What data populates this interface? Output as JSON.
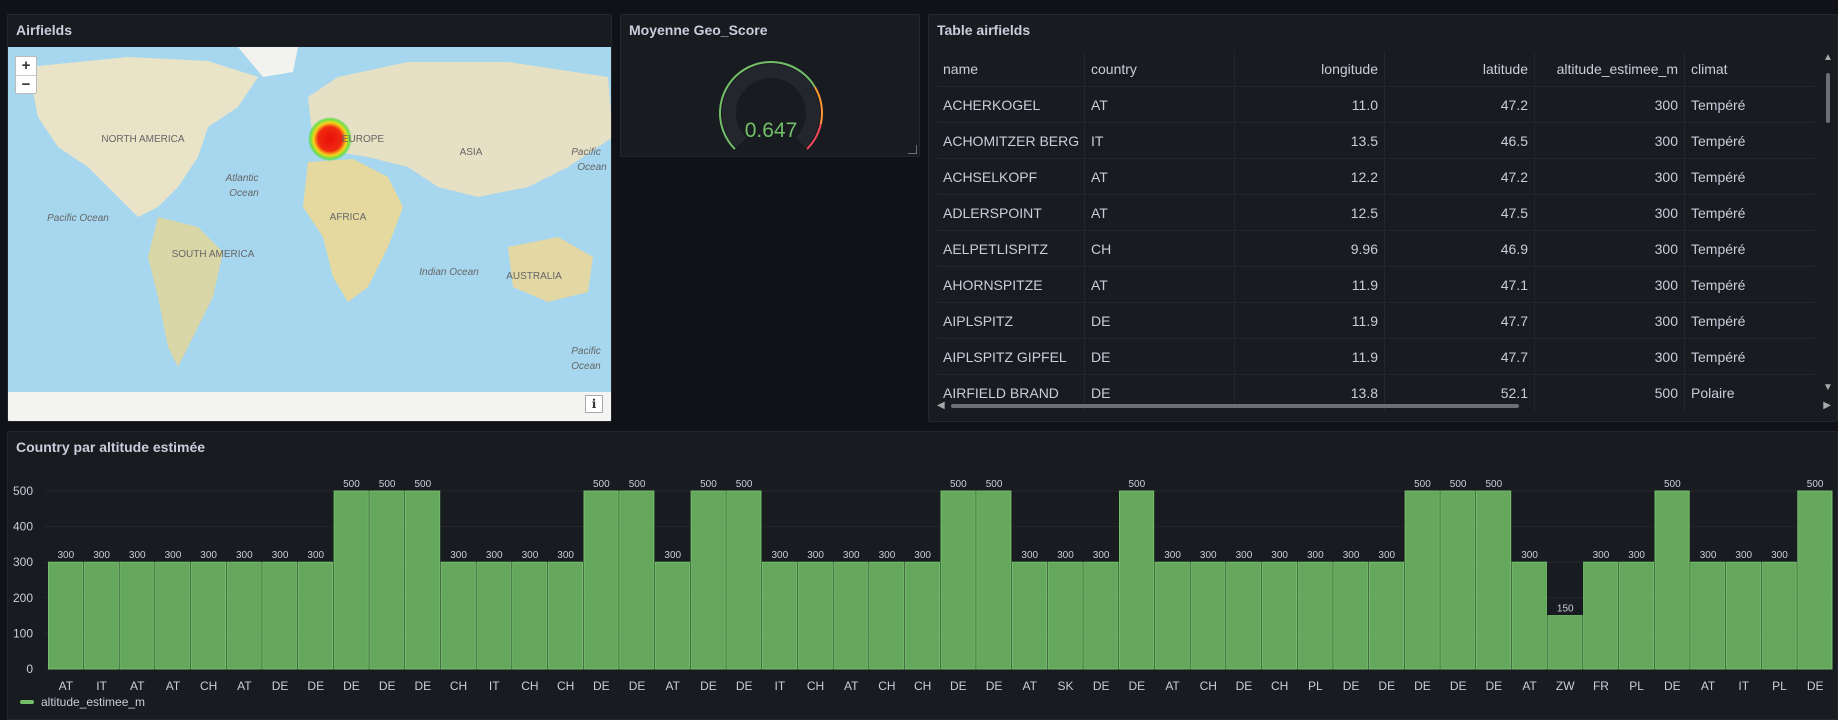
{
  "map_panel": {
    "title": "Airfields",
    "zoom_in": "+",
    "zoom_out": "−",
    "info": "i",
    "labels": [
      "NORTH AMERICA",
      "EUROPE",
      "ASIA",
      "Atlantic",
      "Ocean",
      "AFRICA",
      "Pacific Ocean",
      "SOUTH AMERICA",
      "Indian Ocean",
      "AUSTRALIA",
      "Pacific",
      "Ocean",
      "Pacific",
      "Ocean"
    ]
  },
  "gauge_panel": {
    "title": "Moyenne Geo_Score",
    "value": "0.647",
    "value_color": "#73bf69",
    "fraction": 0.647
  },
  "table_panel": {
    "title": "Table airfields",
    "columns": [
      "name",
      "country",
      "longitude",
      "latitude",
      "altitude_estimee_m",
      "climat"
    ],
    "rows": [
      [
        "ACHERKOGEL",
        "AT",
        "11.0",
        "47.2",
        "300",
        "Tempéré"
      ],
      [
        "ACHOMITZER BERG",
        "IT",
        "13.5",
        "46.5",
        "300",
        "Tempéré"
      ],
      [
        "ACHSELKOPF",
        "AT",
        "12.2",
        "47.2",
        "300",
        "Tempéré"
      ],
      [
        "ADLERSPOINT",
        "AT",
        "12.5",
        "47.5",
        "300",
        "Tempéré"
      ],
      [
        "AELPETLISPITZ",
        "CH",
        "9.96",
        "46.9",
        "300",
        "Tempéré"
      ],
      [
        "AHORNSPITZE",
        "AT",
        "11.9",
        "47.1",
        "300",
        "Tempéré"
      ],
      [
        "AIPLSPITZ",
        "DE",
        "11.9",
        "47.7",
        "300",
        "Tempéré"
      ],
      [
        "AIPLSPITZ GIPFEL",
        "DE",
        "11.9",
        "47.7",
        "300",
        "Tempéré"
      ],
      [
        "AIRFIELD BRAND",
        "DE",
        "13.8",
        "52.1",
        "500",
        "Polaire"
      ]
    ]
  },
  "bar_panel": {
    "title": "Country par altitude estimée",
    "legend": "altitude_estimee_m"
  },
  "chart_data": {
    "type": "bar",
    "title": "Country par altitude estimée",
    "series_name": "altitude_estimee_m",
    "color": "#73bf69",
    "ylim": [
      0,
      500
    ],
    "yticks": [
      0,
      100,
      200,
      300,
      400,
      500
    ],
    "grid": true,
    "legend_position": "bottom-left",
    "categories": [
      "AT",
      "IT",
      "AT",
      "AT",
      "CH",
      "AT",
      "DE",
      "DE",
      "DE",
      "DE",
      "DE",
      "CH",
      "IT",
      "CH",
      "CH",
      "DE",
      "DE",
      "AT",
      "DE",
      "DE",
      "IT",
      "CH",
      "AT",
      "CH",
      "CH",
      "DE",
      "DE",
      "AT",
      "SK",
      "DE",
      "DE",
      "AT",
      "CH",
      "DE",
      "CH",
      "PL",
      "DE",
      "DE",
      "DE",
      "DE",
      "DE",
      "AT",
      "ZW",
      "FR",
      "PL",
      "DE",
      "AT",
      "IT",
      "PL",
      "DE"
    ],
    "values": [
      300,
      300,
      300,
      300,
      300,
      300,
      300,
      300,
      500,
      500,
      500,
      300,
      300,
      300,
      300,
      500,
      500,
      300,
      500,
      500,
      300,
      300,
      300,
      300,
      300,
      500,
      500,
      300,
      300,
      300,
      500,
      300,
      300,
      300,
      300,
      300,
      300,
      300,
      500,
      500,
      500,
      300,
      150,
      300,
      300,
      500,
      300,
      300,
      300,
      500
    ]
  }
}
